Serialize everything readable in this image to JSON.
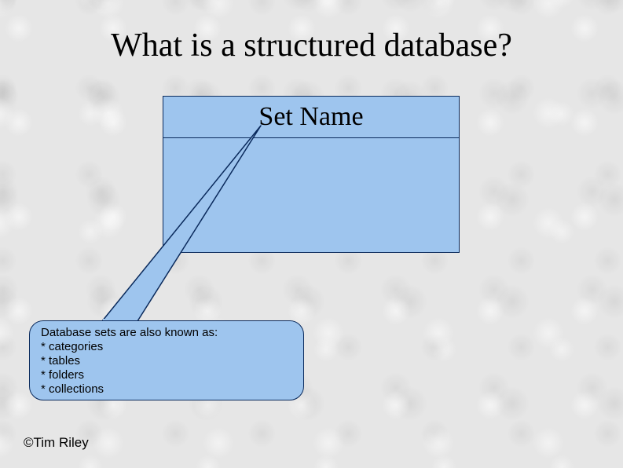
{
  "colors": {
    "box_fill": "#9ec5ee",
    "box_border": "#0a2a5c"
  },
  "title": "What is a structured database?",
  "set_box": {
    "header": "Set Name"
  },
  "callout": {
    "intro": "Database sets are also known as:",
    "items": [
      "categories",
      "tables",
      "folders",
      "collections"
    ]
  },
  "credit": "©Tim Riley"
}
